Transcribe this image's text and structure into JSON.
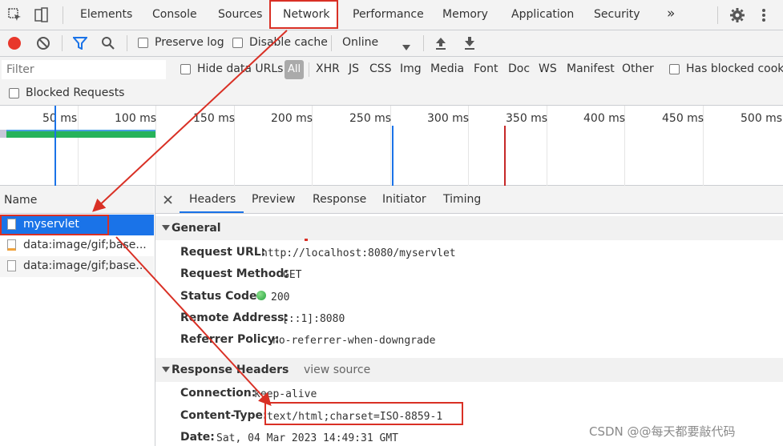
{
  "tabs": [
    "Elements",
    "Console",
    "Sources",
    "Network",
    "Performance",
    "Memory",
    "Application",
    "Security",
    "»"
  ],
  "toolbar": {
    "preserve_log": "Preserve log",
    "disable_cache": "Disable cache",
    "throttle": "Online"
  },
  "filter": {
    "placeholder": "Filter",
    "hide_data_urls": "Hide data URLs",
    "types": [
      "All",
      "XHR",
      "JS",
      "CSS",
      "Img",
      "Media",
      "Font",
      "Doc",
      "WS",
      "Manifest",
      "Other"
    ],
    "has_blocked_cookies": "Has blocked cooki",
    "blocked_requests": "Blocked Requests"
  },
  "timeline": {
    "ticks": [
      "50 ms",
      "100 ms",
      "150 ms",
      "200 ms",
      "250 ms",
      "300 ms",
      "350 ms",
      "400 ms",
      "450 ms",
      "500 ms"
    ]
  },
  "requests": {
    "header": "Name",
    "items": [
      "myservlet",
      "data:image/gif;base...",
      "data:image/gif;base..."
    ]
  },
  "detail_tabs": [
    "Headers",
    "Preview",
    "Response",
    "Initiator",
    "Timing"
  ],
  "general": {
    "title": "General",
    "rows": [
      {
        "key": "Request URL:",
        "value": "http://localhost:8080/myservlet"
      },
      {
        "key": "Request Method:",
        "value": "GET"
      },
      {
        "key": "Status Code:",
        "value": "200"
      },
      {
        "key": "Remote Address:",
        "value": "[::1]:8080"
      },
      {
        "key": "Referrer Policy:",
        "value": "no-referrer-when-downgrade"
      }
    ]
  },
  "response_headers": {
    "title": "Response Headers",
    "view_source": "view source",
    "rows": [
      {
        "key": "Connection:",
        "value": "keep-alive"
      },
      {
        "key": "Content-Type:",
        "value": "text/html;charset=ISO-8859-1"
      },
      {
        "key": "Date:",
        "value": "Sat, 04 Mar 2023 14:49:31 GMT"
      }
    ]
  },
  "watermark": "CSDN @@每天都要敲代码",
  "colors": {
    "accent_red": "#d93025",
    "selected_blue": "#1a73e8",
    "status_green": "#24a13d",
    "record_red": "#e8372b"
  }
}
